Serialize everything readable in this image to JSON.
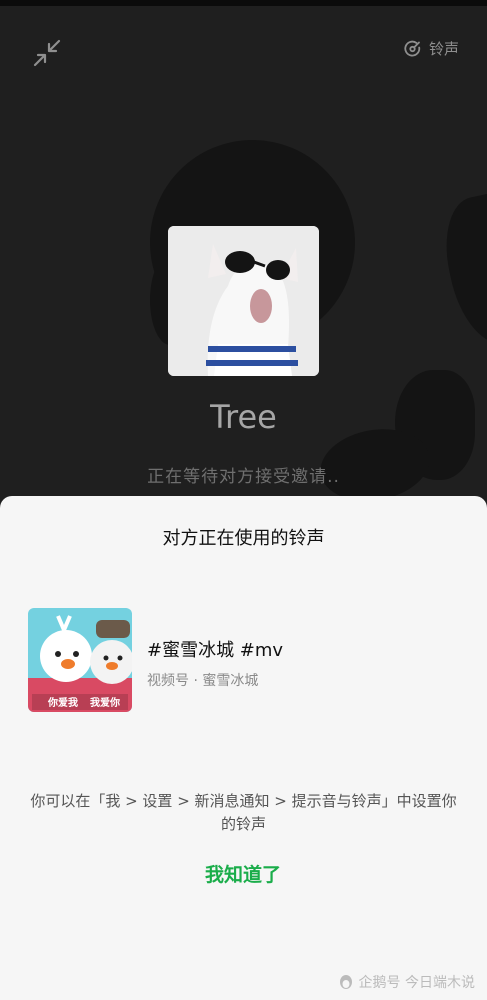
{
  "header": {
    "ringtone_label": "铃声"
  },
  "caller": {
    "name": "Tree",
    "status": "正在等待对方接受邀请.."
  },
  "sheet": {
    "title": "对方正在使用的铃声",
    "song": {
      "title": "#蜜雪冰城 #mv",
      "source": "视频号 · 蜜雪冰城",
      "thumb_caption_left": "你爱我",
      "thumb_caption_right": "我爱你"
    },
    "hint": "你可以在「我 > 设置 > 新消息通知 > 提示音与铃声」中设置你的铃声",
    "confirm_label": "我知道了"
  },
  "watermark": {
    "text": "企鹅号 今日端木说"
  },
  "colors": {
    "accent": "#1aad4a",
    "background": "#1f1f1f",
    "sheet": "#f6f6f6"
  },
  "icons": {
    "minimize": "minimize-arrows-icon",
    "ringtone": "ringtone-icon",
    "watermark": "penguin-icon"
  }
}
